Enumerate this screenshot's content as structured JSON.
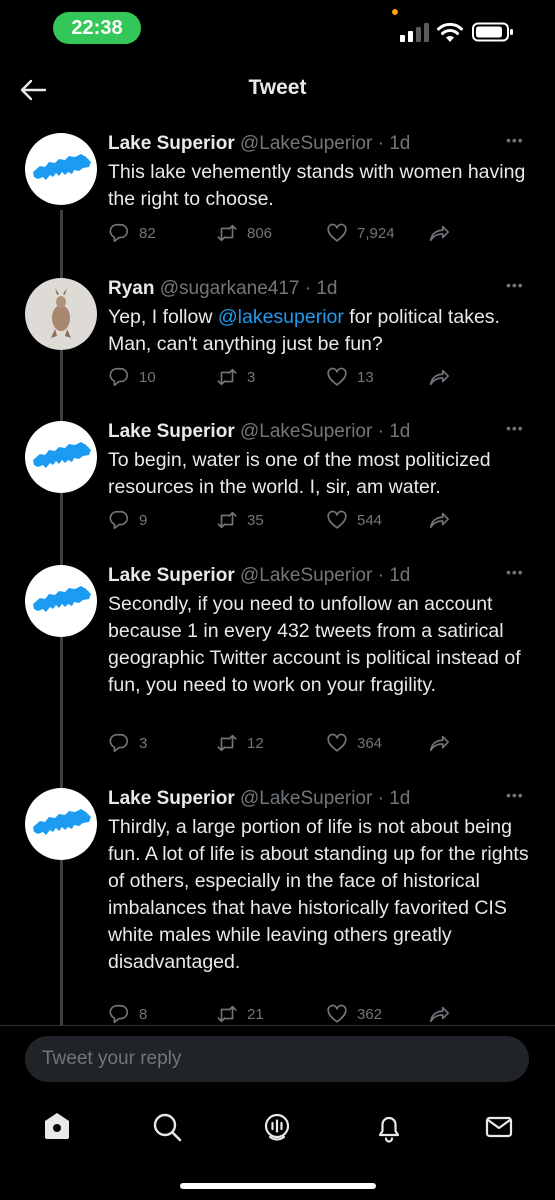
{
  "status_bar": {
    "time": "22:38"
  },
  "header": {
    "title": "Tweet"
  },
  "tweets": [
    {
      "name": "Lake Superior",
      "handle": "@LakeSuperior",
      "time": "1d",
      "segments": [
        "This lake vehemently stands with women having the right to choose."
      ],
      "replies": "82",
      "retweets": "806",
      "likes": "7,924"
    },
    {
      "name": "Ryan",
      "handle": "@sugarkane417",
      "time": "1d",
      "segments": [
        "Yep, I follow ",
        "@lakesuperior",
        " for political takes.  Man, can't anything just be fun?"
      ],
      "replies": "10",
      "retweets": "3",
      "likes": "13"
    },
    {
      "name": "Lake Superior",
      "handle": "@LakeSuperior",
      "time": "1d",
      "segments": [
        "To begin, water is one of the most politicized resources in the world. I, sir, am water."
      ],
      "replies": "9",
      "retweets": "35",
      "likes": "544"
    },
    {
      "name": "Lake Superior",
      "handle": "@LakeSuperior",
      "time": "1d",
      "segments": [
        "Secondly, if you need to unfollow an account because 1 in every 432 tweets from a satirical geographic Twitter account is political instead of fun, you need to work on your fragility."
      ],
      "replies": "3",
      "retweets": "12",
      "likes": "364"
    },
    {
      "name": "Lake Superior",
      "handle": "@LakeSuperior",
      "time": "1d",
      "segments": [
        "Thirdly, a large portion of life is not about being fun. A lot of life is about standing up for the rights of others, especially in the face of historical imbalances that have historically favorited CIS white males while leaving others greatly disadvantaged."
      ],
      "replies": "8",
      "retweets": "21",
      "likes": "362"
    }
  ],
  "reply_box": {
    "placeholder": "Tweet your reply"
  },
  "nav": [
    "home-icon",
    "search-icon",
    "spaces-icon",
    "notifications-icon",
    "messages-icon"
  ],
  "colors": {
    "background": "#000000",
    "link": "#1d9bf0",
    "muted": "#71767b",
    "status_pill": "#34c759"
  }
}
